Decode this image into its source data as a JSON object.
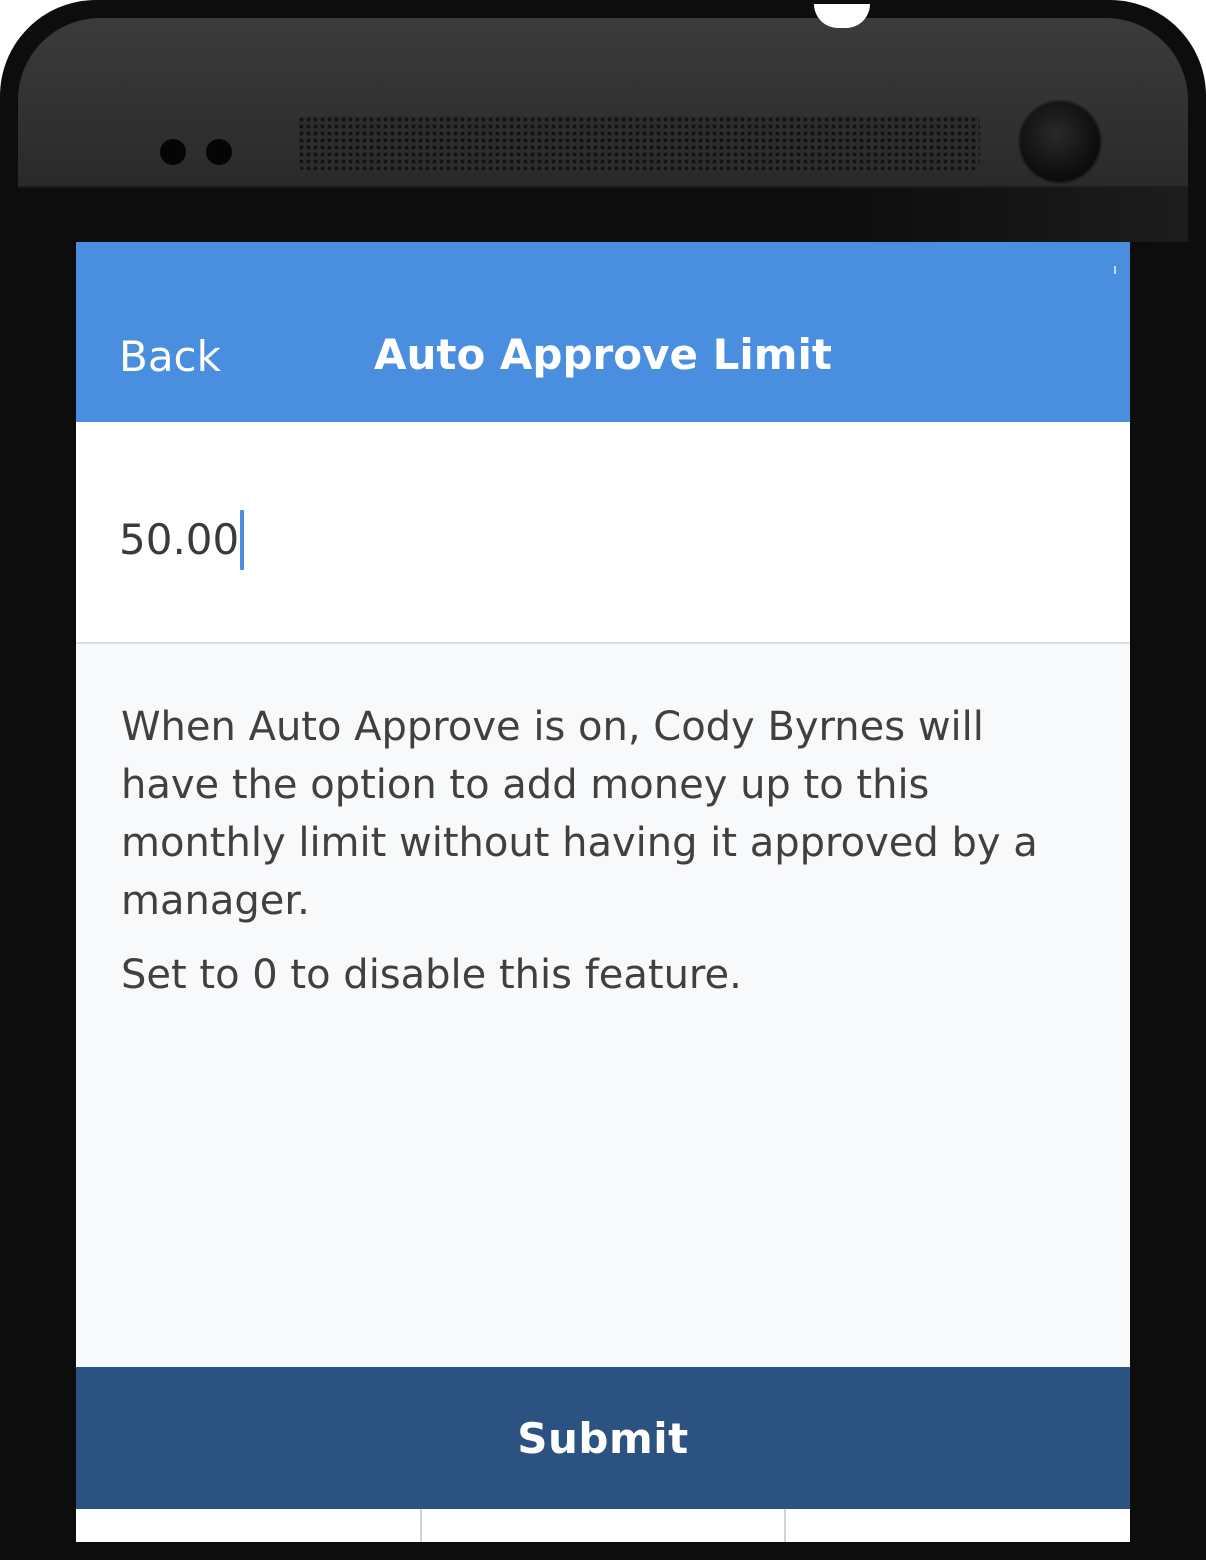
{
  "header": {
    "back_label": "Back",
    "title": "Auto Approve Limit"
  },
  "limit_input": {
    "value": "50.00"
  },
  "description": {
    "paragraph_1": "When Auto Approve is on, Cody Byrnes will have the option to add money up to this monthly limit without having it approved by a manager.",
    "paragraph_2": "Set to 0 to disable this feature."
  },
  "submit": {
    "label": "Submit"
  },
  "colors": {
    "header": "#4a8ee0",
    "submit": "#2b5281",
    "caret": "#4a8ee0"
  }
}
